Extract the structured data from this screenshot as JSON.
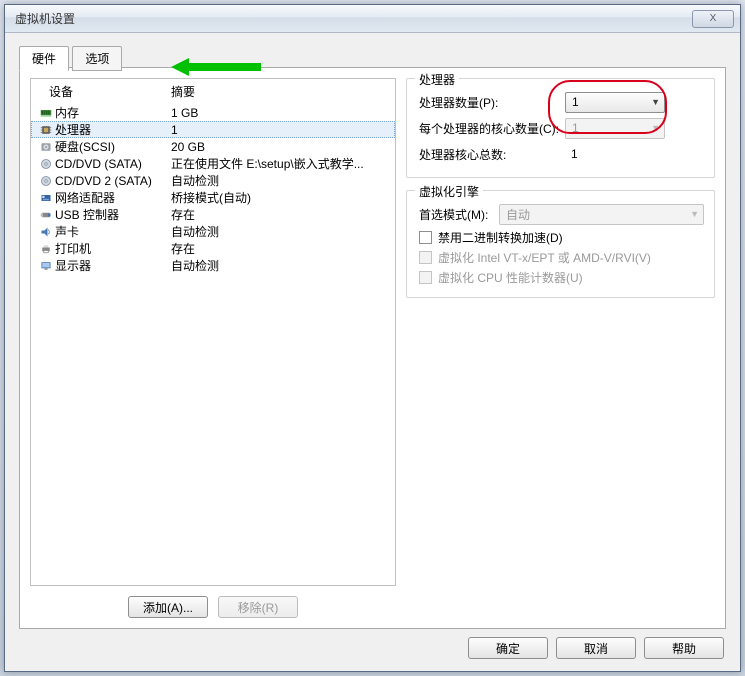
{
  "window": {
    "title": "虚拟机设置",
    "close_x": "X"
  },
  "tabs": {
    "hardware": "硬件",
    "options": "选项"
  },
  "list": {
    "header_device": "设备",
    "header_summary": "摘要"
  },
  "devices": [
    {
      "icon": "memory-icon",
      "name": "内存",
      "summary": "1 GB"
    },
    {
      "icon": "cpu-icon",
      "name": "处理器",
      "summary": "1",
      "selected": true
    },
    {
      "icon": "hdd-icon",
      "name": "硬盘(SCSI)",
      "summary": "20 GB"
    },
    {
      "icon": "cd-icon",
      "name": "CD/DVD (SATA)",
      "summary": "正在使用文件 E:\\setup\\嵌入式教学..."
    },
    {
      "icon": "cd-icon",
      "name": "CD/DVD 2 (SATA)",
      "summary": "自动检测"
    },
    {
      "icon": "nic-icon",
      "name": "网络适配器",
      "summary": "桥接模式(自动)"
    },
    {
      "icon": "usb-icon",
      "name": "USB 控制器",
      "summary": "存在"
    },
    {
      "icon": "sound-icon",
      "name": "声卡",
      "summary": "自动检测"
    },
    {
      "icon": "printer-icon",
      "name": "打印机",
      "summary": "存在"
    },
    {
      "icon": "display-icon",
      "name": "显示器",
      "summary": "自动检测"
    }
  ],
  "buttons": {
    "add": "添加(A)...",
    "remove": "移除(R)",
    "ok": "确定",
    "cancel": "取消",
    "help": "帮助"
  },
  "processors": {
    "group_title": "处理器",
    "count_label": "处理器数量(P):",
    "count_value": "1",
    "cores_label": "每个处理器的核心数量(C):",
    "cores_value": "1",
    "total_label": "处理器核心总数:",
    "total_value": "1"
  },
  "virt": {
    "group_title": "虚拟化引擎",
    "pref_mode_label": "首选模式(M):",
    "pref_mode_value": "自动",
    "chk1": "禁用二进制转换加速(D)",
    "chk2": "虚拟化 Intel VT-x/EPT 或 AMD-V/RVI(V)",
    "chk3": "虚拟化 CPU 性能计数器(U)"
  }
}
